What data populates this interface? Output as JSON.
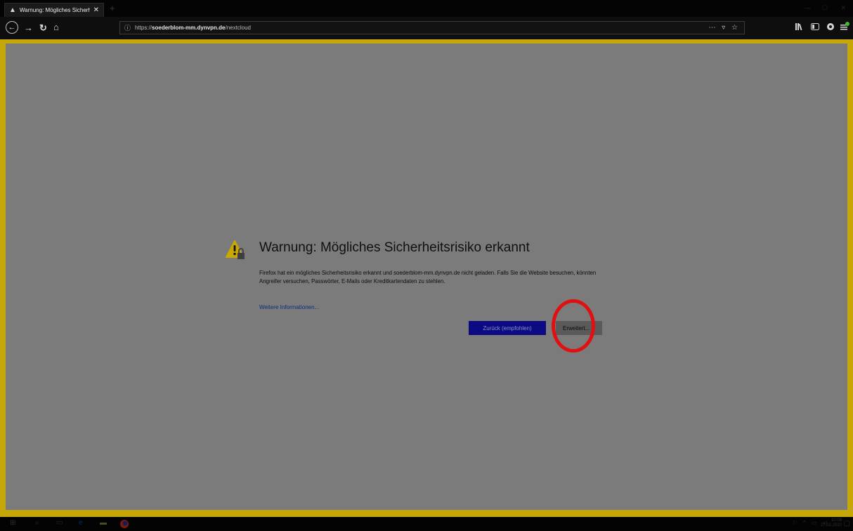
{
  "browser": {
    "tab": {
      "title": "Warnung: Mögliches Sicherhei",
      "close_glyph": "✕"
    },
    "new_tab_glyph": "+",
    "window_controls": [
      "—",
      "☐",
      "✕"
    ],
    "nav": {
      "back": "←",
      "forward": "→",
      "reload": "↻",
      "home": "⌂"
    },
    "urlbar": {
      "info_glyph": "ⓘ",
      "scheme": "https://",
      "host": "soederblom-mm.dynvpn.de",
      "path": "/nextcloud",
      "actions": "⋯ ▿ ☆"
    },
    "toolbar_icons": [
      "library-icon",
      "sidebar-icon",
      "extension-icon",
      "menu-icon"
    ]
  },
  "page": {
    "title": "Warnung: Mögliches Sicherheitsrisiko erkannt",
    "description": "Firefox hat ein mögliches Sicherheitsrisiko erkannt und soederblom-mm.dynvpn.de nicht geladen. Falls Sie die Website besuchen, könnten Angreifer versuchen, Passwörter, E-Mails oder Kreditkartendaten zu stehlen.",
    "more_info_link": "Weitere Informationen...",
    "back_button": "Zurück (empfohlen)",
    "advanced_button": "Erweitert..."
  },
  "taskbar": {
    "time": "10:08",
    "date": "27.02.2020"
  },
  "colors": {
    "page_bg": "#7b7b7b",
    "frame": "#c6a70a",
    "primary_button": "#0b0a83",
    "highlight": "#e01010",
    "link": "#0b2e7a"
  }
}
